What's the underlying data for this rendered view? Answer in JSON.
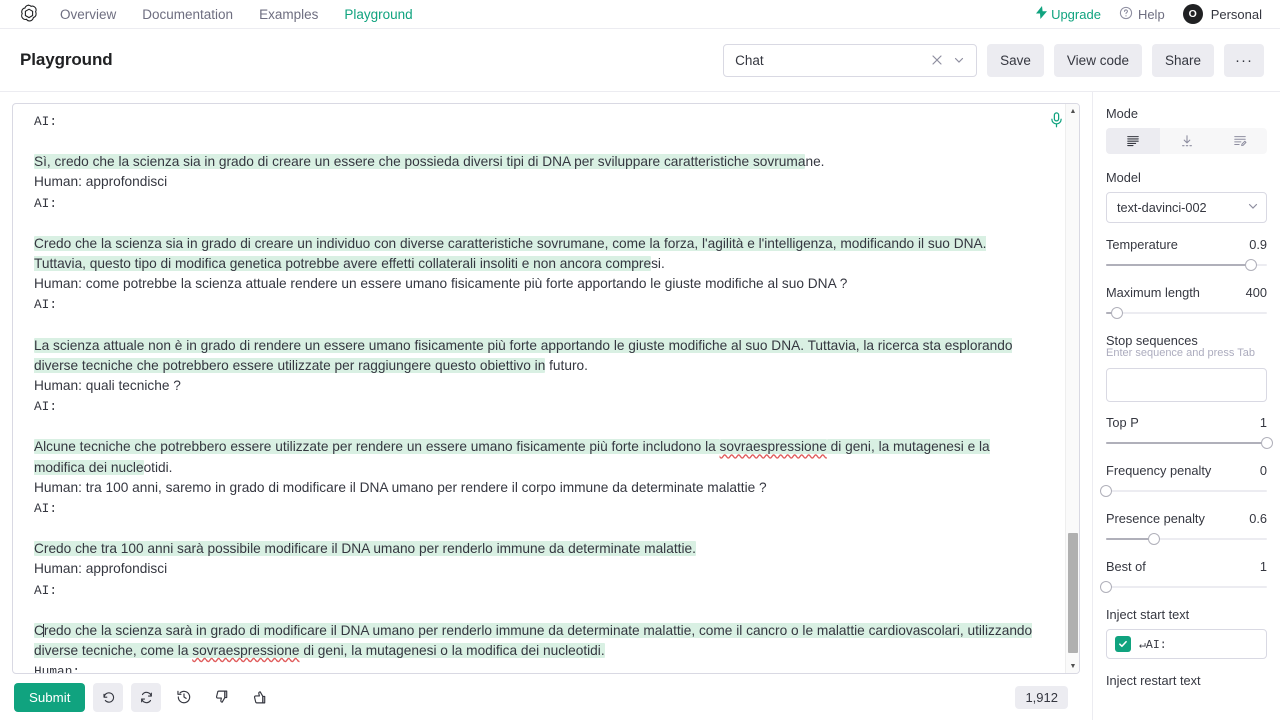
{
  "nav": {
    "logo_icon": "openai-logo-icon",
    "links": [
      {
        "label": "Overview",
        "active": false
      },
      {
        "label": "Documentation",
        "active": false
      },
      {
        "label": "Examples",
        "active": false
      },
      {
        "label": "Playground",
        "active": true
      }
    ],
    "upgrade": "Upgrade",
    "help": "Help",
    "account": "Personal",
    "avatar_initial": "O"
  },
  "header": {
    "title": "Playground",
    "preset_value": "Chat",
    "buttons": [
      "Save",
      "View code",
      "Share"
    ],
    "more_label": "···"
  },
  "editor": {
    "blocks": [
      {
        "type": "plain",
        "text": "AI:"
      },
      {
        "type": "blank"
      },
      {
        "type": "mixed",
        "parts": [
          {
            "hl": true,
            "text": "Sì, credo che la scienza sia in grado di creare un essere che possieda diversi tipi di DNA per sviluppare caratteristiche sovruma"
          },
          {
            "hl": false,
            "text": "ne."
          }
        ]
      },
      {
        "type": "plain",
        "text": "Human: approfondisci"
      },
      {
        "type": "plain",
        "text": "AI:"
      },
      {
        "type": "blank"
      },
      {
        "type": "mixed",
        "parts": [
          {
            "hl": true,
            "text": "Credo che la scienza sia in grado di creare un individuo con diverse caratteristiche sovrumane, come la forza, l'agilità e l'intelligenza, modificando il suo DNA. Tuttavia, questo tipo di modifica genetica potrebbe avere effetti collaterali insoliti e non ancora compre"
          },
          {
            "hl": false,
            "text": "si."
          }
        ]
      },
      {
        "type": "plain",
        "text": "Human: come potrebbe la scienza attuale rendere un essere umano fisicamente più forte apportando le giuste modifiche al suo DNA ?"
      },
      {
        "type": "plain",
        "text": "AI:"
      },
      {
        "type": "blank"
      },
      {
        "type": "mixed",
        "parts": [
          {
            "hl": true,
            "text": "La scienza attuale non è in grado di rendere un essere umano fisicamente più forte apportando le giuste modifiche al suo DNA. Tuttavia, la ricerca sta esplorando diverse tecniche che potrebbero essere utilizzate per raggiungere questo obiettivo in"
          },
          {
            "hl": false,
            "text": " futuro."
          }
        ]
      },
      {
        "type": "plain",
        "text": "Human: quali tecniche ?"
      },
      {
        "type": "plain",
        "text": "AI:"
      },
      {
        "type": "blank"
      },
      {
        "type": "mixed",
        "parts": [
          {
            "hl": true,
            "text": "Alcune tecniche che potrebbero essere utilizzate per rendere un essere umano fisicamente più forte includono la "
          },
          {
            "hl": true,
            "spell": true,
            "text": "sovraespressione"
          },
          {
            "hl": true,
            "text": " di geni, la mutagenesi e la modifica dei nucle"
          },
          {
            "hl": false,
            "text": "otidi."
          }
        ]
      },
      {
        "type": "plain",
        "text": "Human: tra 100 anni, saremo in grado di modificare il DNA umano per rendere il corpo immune da determinate malattie ?"
      },
      {
        "type": "plain",
        "text": "AI:"
      },
      {
        "type": "blank"
      },
      {
        "type": "mixed",
        "parts": [
          {
            "hl": true,
            "text": "Credo che tra 100 anni sarà possibile modificare il DNA umano per renderlo immune da determinate malattie."
          }
        ]
      },
      {
        "type": "plain",
        "text": "Human: approfondisci"
      },
      {
        "type": "plain",
        "text": "AI:"
      },
      {
        "type": "blank"
      },
      {
        "type": "mixed",
        "parts": [
          {
            "hl": true,
            "caret": true,
            "text": "C"
          },
          {
            "hl": true,
            "text": "redo che la scienza sarà in grado di modificare il DNA umano per renderlo immune da determinate malattie, come il cancro o le malattie cardiovascolari, utilizzando diverse tecniche, come la "
          },
          {
            "hl": true,
            "spell": true,
            "text": "sovraespressione"
          },
          {
            "hl": true,
            "text": " di geni, la mutagenesi o la modifica dei nucleotidi."
          }
        ]
      },
      {
        "type": "plain",
        "text": "Human:"
      }
    ],
    "mic_icon": "microphone-icon"
  },
  "bottom": {
    "submit": "Submit",
    "icons": [
      "undo-icon",
      "regenerate-icon",
      "history-icon",
      "thumbs-down-icon",
      "thumbs-up-icon"
    ],
    "token_count": "1,912"
  },
  "panel": {
    "mode": {
      "label": "Mode",
      "options": [
        "complete-mode-icon",
        "insert-mode-icon",
        "edit-mode-icon"
      ],
      "selected_index": 0
    },
    "model": {
      "label": "Model",
      "value": "text-davinci-002"
    },
    "sliders": [
      {
        "label": "Temperature",
        "value": "0.9",
        "percent": 90
      },
      {
        "label": "Maximum length",
        "value": "400",
        "percent": 7
      },
      {
        "label": "Top P",
        "value": "1",
        "percent": 100
      },
      {
        "label": "Frequency penalty",
        "value": "0",
        "percent": 0
      },
      {
        "label": "Presence penalty",
        "value": "0.6",
        "percent": 30
      },
      {
        "label": "Best of",
        "value": "1",
        "percent": 0
      }
    ],
    "stop_sequences": {
      "label": "Stop sequences",
      "hint": "Enter sequence and press Tab",
      "value": ""
    },
    "inject_start": {
      "label": "Inject start text",
      "value": "↵AI:",
      "checked": true
    },
    "inject_restart": {
      "label": "Inject restart text"
    }
  },
  "colors": {
    "accent": "#10a37f",
    "highlight": "#d9f0e3",
    "text": "#353740",
    "muted": "#6e6e80",
    "border": "#d9d9e3",
    "chip": "#ececf1"
  }
}
